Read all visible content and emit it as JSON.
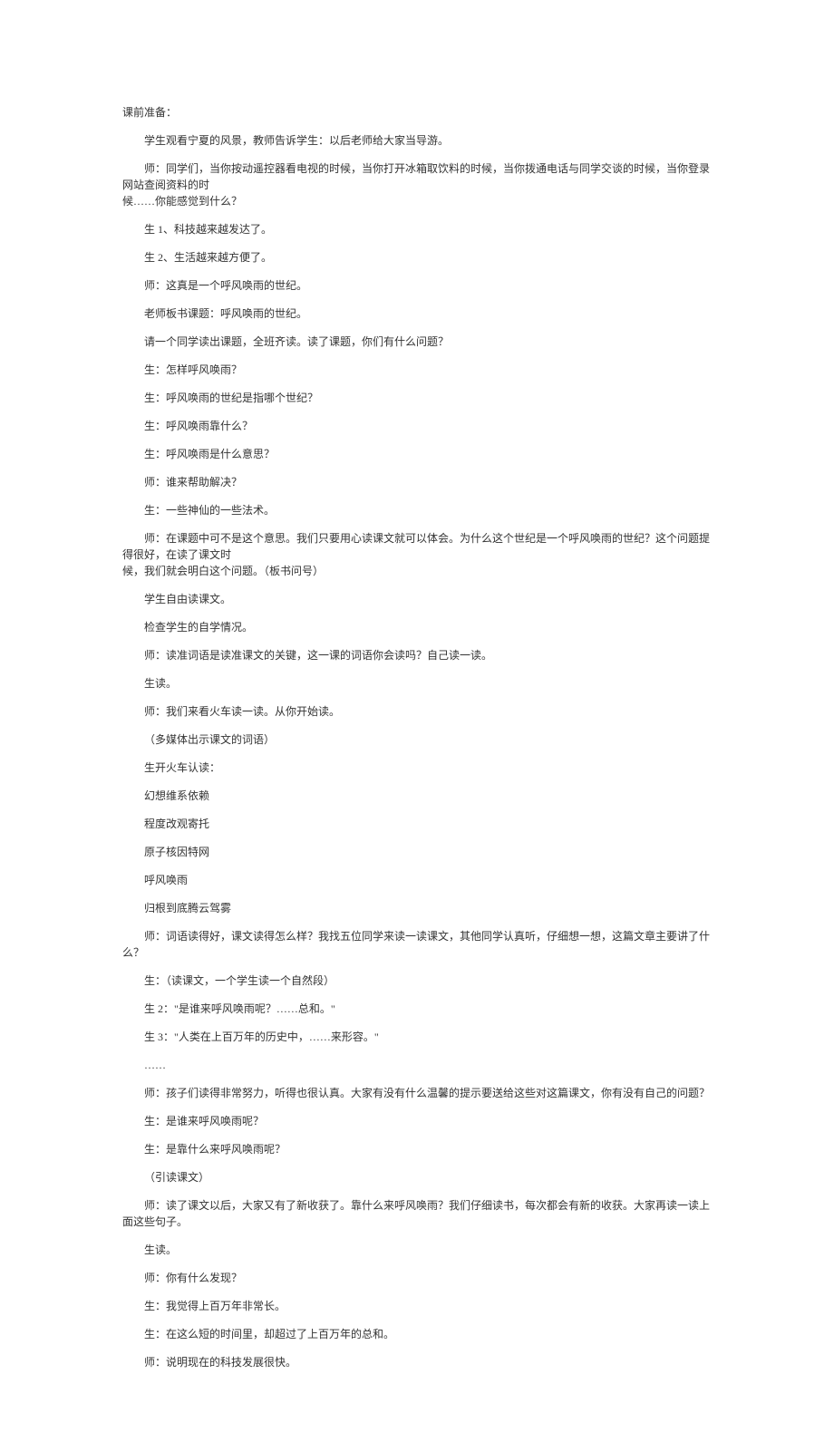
{
  "lines": [
    {
      "text": "课前准备：",
      "indent": 0
    },
    {
      "text": "学生观看宁夏的风景，教师告诉学生：以后老师给大家当导游。",
      "indent": 1
    },
    {
      "text": "师：同学们，当你按动遥控器看电视的时候，当你打开冰箱取饮料的时候，当你拨通电话与同学交谈的时候，当你登录网站查阅资料的时",
      "indent": 1
    },
    {
      "text": "候……你能感觉到什么？",
      "indent": 0,
      "cont": true
    },
    {
      "text": "生 1、科技越来越发达了。",
      "indent": 1
    },
    {
      "text": "生 2、生活越来越方便了。",
      "indent": 1
    },
    {
      "text": "师：这真是一个呼风唤雨的世纪。",
      "indent": 1
    },
    {
      "text": "老师板书课题：呼风唤雨的世纪。",
      "indent": 1
    },
    {
      "text": "请一个同学读出课题，全班齐读。读了课题，你们有什么问题？",
      "indent": 1
    },
    {
      "text": "生：怎样呼风唤雨？",
      "indent": 1
    },
    {
      "text": "生：呼风唤雨的世纪是指哪个世纪？",
      "indent": 1
    },
    {
      "text": "生：呼风唤雨靠什么？",
      "indent": 1
    },
    {
      "text": "生：呼风唤雨是什么意思？",
      "indent": 1
    },
    {
      "text": "师：谁来帮助解决？",
      "indent": 1
    },
    {
      "text": "生：一些神仙的一些法术。",
      "indent": 1
    },
    {
      "text": "师：在课题中可不是这个意思。我们只要用心读课文就可以体会。为什么这个世纪是一个呼风唤雨的世纪？这个问题提得很好，在读了课文时",
      "indent": 1
    },
    {
      "text": "候，我们就会明白这个问题。（板书问号）",
      "indent": 0,
      "cont": true
    },
    {
      "text": "学生自由读课文。",
      "indent": 1
    },
    {
      "text": "检查学生的自学情况。",
      "indent": 1
    },
    {
      "text": "师：读准词语是读准课文的关键，这一课的词语你会读吗？自己读一读。",
      "indent": 1
    },
    {
      "text": "生读。",
      "indent": 1
    },
    {
      "text": "师：我们来看火车读一读。从你开始读。",
      "indent": 1
    },
    {
      "text": "（多媒体出示课文的词语）",
      "indent": 1
    },
    {
      "text": "生开火车认读：",
      "indent": 1
    },
    {
      "text": "幻想维系依赖",
      "indent": 1
    },
    {
      "text": "程度改观寄托",
      "indent": 1
    },
    {
      "text": "原子核因特网",
      "indent": 1
    },
    {
      "text": "呼风唤雨",
      "indent": 1
    },
    {
      "text": "归根到底腾云驾雾",
      "indent": 1
    },
    {
      "text": "师：词语读得好，课文读得怎么样？我找五位同学来读一读课文，其他同学认真听，仔细想一想，这篇文章主要讲了什么？",
      "indent": 1
    },
    {
      "text": "生：（读课文，一个学生读一个自然段）",
      "indent": 1
    },
    {
      "text": "生 2：\"是谁来呼风唤雨呢？……总和。\"",
      "indent": 1
    },
    {
      "text": "生 3：\"人类在上百万年的历史中，……来形容。\"",
      "indent": 1
    },
    {
      "text": "……",
      "indent": 1
    },
    {
      "text": "师：孩子们读得非常努力，听得也很认真。大家有没有什么温馨的提示要送给这些对这篇课文，你有没有自己的问题？",
      "indent": 1
    },
    {
      "text": "生：是谁来呼风唤雨呢？",
      "indent": 1
    },
    {
      "text": "生：是靠什么来呼风唤雨呢？",
      "indent": 1
    },
    {
      "text": "（引读课文）",
      "indent": 1
    },
    {
      "text": "师：读了课文以后，大家又有了新收获了。靠什么来呼风唤雨？我们仔细读书，每次都会有新的收获。大家再读一读上面这些句子。",
      "indent": 1
    },
    {
      "text": "生读。",
      "indent": 1
    },
    {
      "text": "师：你有什么发现？",
      "indent": 1
    },
    {
      "text": "生：我觉得上百万年非常长。",
      "indent": 1
    },
    {
      "text": "生：在这么短的时间里，却超过了上百万年的总和。",
      "indent": 1
    },
    {
      "text": "师：说明现在的科技发展很快。",
      "indent": 1
    }
  ]
}
